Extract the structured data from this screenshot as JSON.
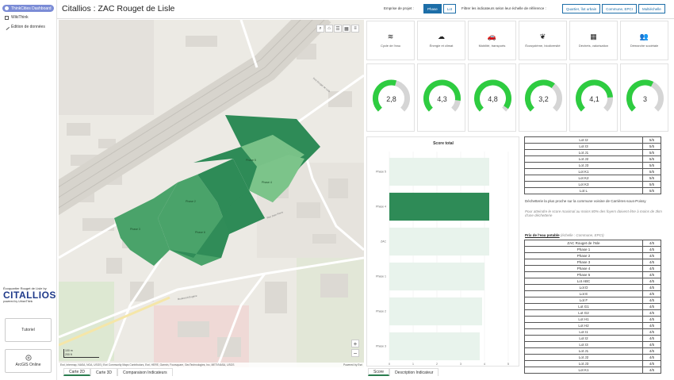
{
  "sidebar": {
    "items": [
      {
        "label": "ThinkCities Dashboard",
        "icon": "dashboard-icon"
      },
      {
        "label": "WikiThink",
        "icon": "document-icon"
      },
      {
        "label": "Édition de données",
        "icon": "edit-icon"
      }
    ],
    "logo": {
      "line1": "Écoquartier Rouget de Lisle by",
      "name": "CITALLIOS",
      "line3": "powered by UrbanThink"
    },
    "tutorial_label": "Tutoriel",
    "arcgis_label": "ArcGIS Online"
  },
  "header": {
    "title": "Citallios : ZAC Rouget de Lisle",
    "emprise_label": "Emprise de projet :",
    "emprise_options": [
      "Phase",
      "Lot"
    ],
    "emprise_selected": "Phase",
    "filter_label": "Filtrer les indicateurs selon leur échelle de référence :",
    "filter_options": [
      "Quartier, îlot urbain",
      "Commune, EPCI",
      "Multiéchelle"
    ]
  },
  "map": {
    "labels": [
      "Phase 1",
      "Phase 2",
      "Phase 3",
      "Phase 4",
      "Phase 5",
      "Phase 6"
    ],
    "roads": [
      "Rue Rouget de Lisle",
      "Rue Jean Pierre",
      "Rue de Castelmoron",
      "Rue Jean Rostand",
      "Rue Pierre Curie",
      "Rue Paul Armangot",
      "Boulevard Eugène"
    ],
    "scale": [
      "100 m",
      "200 ft"
    ],
    "attribution": "Esri, Intermap, NASA, NGA, USGS | Esri Community Maps Contributors, Esri, HERE, Garmin, Foursquare, GeoTechnologies, Inc, METI/NASA, USGS",
    "powered": "Powered by Esri",
    "tabs": [
      "Carte 2D",
      "Carte 3D",
      "Comparaison Indicateurs"
    ],
    "active_tab": "Carte 2D"
  },
  "indicators": [
    {
      "label": "Cycle de l'eau",
      "icon": "water-icon",
      "glyph": "≋",
      "value": 2.8,
      "display": "2,8"
    },
    {
      "label": "Énergie et climat",
      "icon": "weather-icon",
      "glyph": "☁",
      "value": 4.3,
      "display": "4,3"
    },
    {
      "label": "Mobilité, transports",
      "icon": "car-icon",
      "glyph": "🚗",
      "value": 4.8,
      "display": "4,8"
    },
    {
      "label": "Écosystème, biodiversité",
      "icon": "leaf-icon",
      "glyph": "❦",
      "value": 3.2,
      "display": "3,2"
    },
    {
      "label": "Déchets, valorisation",
      "icon": "factory-icon",
      "glyph": "▦",
      "value": 4.1,
      "display": "4,1"
    },
    {
      "label": "Démarche sociétale",
      "icon": "people-icon",
      "glyph": "👥",
      "value": 3,
      "display": "3"
    }
  ],
  "gauge_max": 5,
  "colors": {
    "gauge": "#2ecc40",
    "gauge_track": "#d5d5d5",
    "bar_active": "#2e8b57",
    "bar_light": "#e8f3ec",
    "phase_dark": "#2e8b57",
    "phase_mid": "#4aa36a",
    "phase_light": "#7cc48a",
    "accent": "#1d6ea8"
  },
  "chart_data": {
    "type": "bar",
    "orientation": "horizontal",
    "title": "Score total",
    "categories": [
      "Phase 5",
      "Phase 4",
      "ZAC",
      "Phase 1",
      "Phase 2",
      "Phase 3"
    ],
    "values": [
      4.2,
      4.2,
      4.2,
      4.0,
      3.9,
      3.8
    ],
    "highlighted": "Phase 4",
    "xlim": [
      0,
      5
    ],
    "xticks": [
      "0",
      "1",
      "2",
      "3",
      "4",
      "5"
    ],
    "grid": true
  },
  "score_tabs": [
    "Score",
    "Description Indicateur"
  ],
  "active_score_tab": "Score",
  "table1": {
    "rows": [
      [
        "Lot I2",
        "5/5"
      ],
      [
        "Lot I3",
        "5/5"
      ],
      [
        "Lot J1",
        "5/5"
      ],
      [
        "Lot J2",
        "5/5"
      ],
      [
        "Lot J3",
        "5/5"
      ],
      [
        "Lot K1",
        "5/5"
      ],
      [
        "Lot K2",
        "5/5"
      ],
      [
        "Lot K3",
        "5/5"
      ],
      [
        "Lot L",
        "5/5"
      ]
    ]
  },
  "note1": "Déchetterie la plus proche sur la commune voisine de Carrières-sous-Poissy",
  "note2": "Pour atteindre le score maximal au moins 80% des foyers doivent être à moins de 3km d'une déchetterie",
  "section2": {
    "title": "Prix de l'eau potable",
    "scale": "(échelle : Commune, EPCI)"
  },
  "table2": {
    "rows": [
      [
        "ZAC Rouget de l'Isle",
        "4/5"
      ],
      [
        "Phase 1",
        "4/5"
      ],
      [
        "Phase 2",
        "4/5"
      ],
      [
        "Phase 3",
        "4/5"
      ],
      [
        "Phase 4",
        "4/5"
      ],
      [
        "Phase 5",
        "4/5"
      ],
      [
        "Lot ABC",
        "4/5"
      ],
      [
        "Lot D",
        "4/5"
      ],
      [
        "Lot E",
        "4/5"
      ],
      [
        "Lot F",
        "4/5"
      ],
      [
        "Lot G1",
        "4/5"
      ],
      [
        "Lot G2",
        "4/5"
      ],
      [
        "Lot H1",
        "4/5"
      ],
      [
        "Lot H2",
        "4/5"
      ],
      [
        "Lot I1",
        "4/5"
      ],
      [
        "Lot I2",
        "4/5"
      ],
      [
        "Lot I3",
        "4/5"
      ],
      [
        "Lot J1",
        "4/5"
      ],
      [
        "Lot J2",
        "4/5"
      ],
      [
        "Lot J3",
        "4/5"
      ],
      [
        "Lot K1",
        "4/5"
      ]
    ]
  }
}
